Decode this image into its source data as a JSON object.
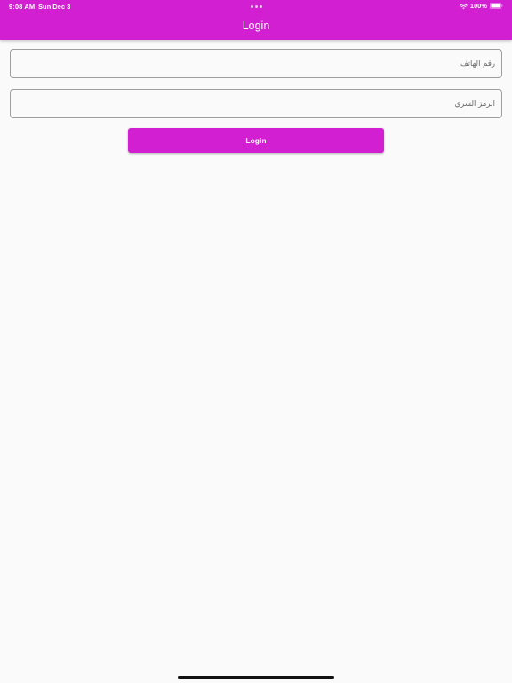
{
  "status_bar": {
    "time": "9:08 AM",
    "date": "Sun Dec 3",
    "battery": "100%"
  },
  "app_bar": {
    "title": "Login"
  },
  "form": {
    "phone_placeholder": "رقم الهاتف",
    "pin_placeholder": "الرمز السري",
    "login_label": "Login"
  },
  "colors": {
    "accent": "#d11fd1",
    "background": "#fafafa",
    "field_border": "#9e9e9e"
  },
  "icons": [
    "wifi-icon",
    "battery-icon"
  ]
}
